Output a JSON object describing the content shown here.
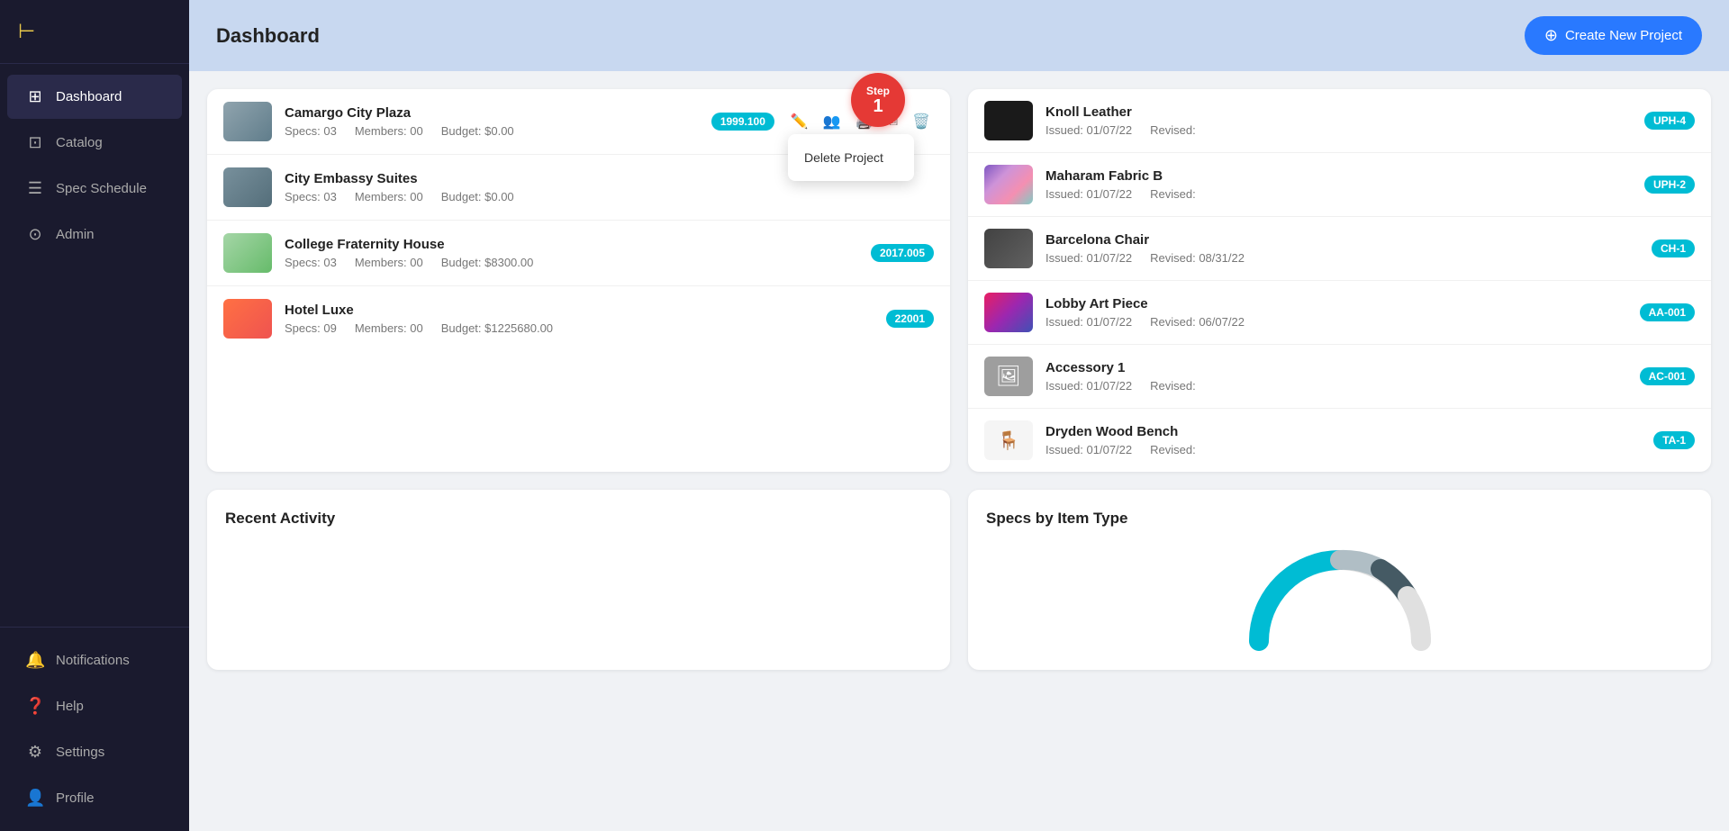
{
  "sidebar": {
    "logo": "⊢",
    "items": [
      {
        "id": "dashboard",
        "label": "Dashboard",
        "icon": "⊞",
        "active": true
      },
      {
        "id": "catalog",
        "label": "Catalog",
        "icon": "⊡",
        "active": false
      },
      {
        "id": "spec-schedule",
        "label": "Spec Schedule",
        "icon": "☰",
        "active": false
      },
      {
        "id": "admin",
        "label": "Admin",
        "icon": "⊙",
        "active": false
      }
    ],
    "bottom_items": [
      {
        "id": "notifications",
        "label": "Notifications",
        "icon": "🔔"
      },
      {
        "id": "help",
        "label": "Help",
        "icon": "?"
      },
      {
        "id": "settings",
        "label": "Settings",
        "icon": "⚙"
      },
      {
        "id": "profile",
        "label": "Profile",
        "icon": "👤"
      }
    ]
  },
  "header": {
    "title": "Dashboard",
    "create_button": "Create New Project"
  },
  "projects": [
    {
      "name": "Camargo City Plaza",
      "specs": "Specs: 03",
      "members": "Members: 00",
      "budget": "Budget: $0.00",
      "tag": "1999.100",
      "img_class": "img-plaza",
      "has_actions": true,
      "has_dropdown": true
    },
    {
      "name": "City Embassy Suites",
      "specs": "Specs: 03",
      "members": "Members: 00",
      "budget": "Budget: $0.00",
      "tag": null,
      "img_class": "img-embassy",
      "has_actions": false,
      "has_dropdown": false
    },
    {
      "name": "College Fraternity House",
      "specs": "Specs: 03",
      "members": "Members: 00",
      "budget": "Budget: $8300.00",
      "tag": "2017.005",
      "img_class": "img-fraternity",
      "has_actions": false,
      "has_dropdown": false
    },
    {
      "name": "Hotel Luxe",
      "specs": "Specs: 09",
      "members": "Members: 00",
      "budget": "Budget: $1225680.00",
      "tag": "22001",
      "img_class": "img-hotel",
      "has_actions": false,
      "has_dropdown": false
    }
  ],
  "step_badge": {
    "label": "Step",
    "number": "1"
  },
  "delete_menu": {
    "item": "Delete Project"
  },
  "specs": [
    {
      "name": "Knoll Leather",
      "issued": "Issued: 01/07/22",
      "revised": "Revised:",
      "tag": "UPH-4",
      "img_class": "img-knoll"
    },
    {
      "name": "Maharam Fabric B",
      "issued": "Issued: 01/07/22",
      "revised": "Revised:",
      "tag": "UPH-2",
      "img_class": "img-maharam"
    },
    {
      "name": "Barcelona Chair",
      "issued": "Issued: 01/07/22",
      "revised": "Revised: 08/31/22",
      "tag": "CH-1",
      "img_class": "img-barcelona"
    },
    {
      "name": "Lobby Art Piece",
      "issued": "Issued: 01/07/22",
      "revised": "Revised: 06/07/22",
      "tag": "AA-001",
      "img_class": "img-lobby"
    },
    {
      "name": "Accessory 1",
      "issued": "Issued: 01/07/22",
      "revised": "Revised:",
      "tag": "AC-001",
      "img_class": "img-accessory"
    },
    {
      "name": "Dryden Wood Bench",
      "issued": "Issued: 01/07/22",
      "revised": "Revised:",
      "tag": "TA-1",
      "img_class": "img-dryden"
    }
  ],
  "recent_activity": {
    "title": "Recent Activity"
  },
  "specs_chart": {
    "title": "Specs by Item Type"
  }
}
